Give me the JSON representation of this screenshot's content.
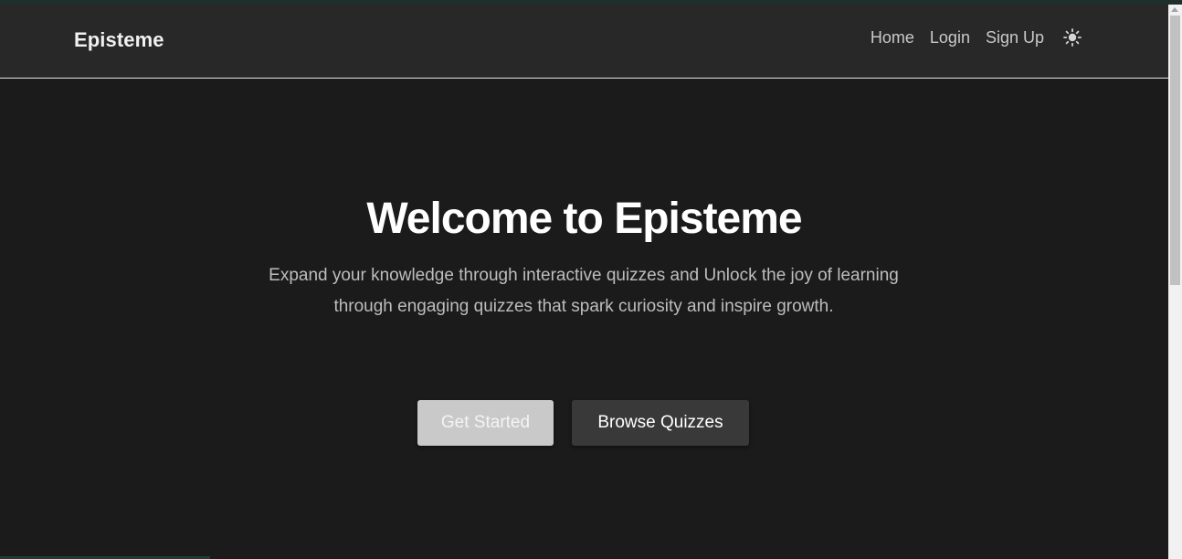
{
  "brand": {
    "name": "Episteme"
  },
  "nav": {
    "links": [
      {
        "label": "Home"
      },
      {
        "label": "Login"
      },
      {
        "label": "Sign Up"
      }
    ],
    "theme_icon": "sun-icon"
  },
  "hero": {
    "title": "Welcome to Episteme",
    "subtitle": "Expand your knowledge through interactive quizzes and Unlock the joy of learning through engaging quizzes that spark curiosity and inspire growth.",
    "primary_button": "Get Started",
    "secondary_button": "Browse Quizzes"
  },
  "colors": {
    "background": "#1b1b1b",
    "navbar": "#282828",
    "primary_button": "#c9c9c9",
    "secondary_button": "#3a393a"
  }
}
